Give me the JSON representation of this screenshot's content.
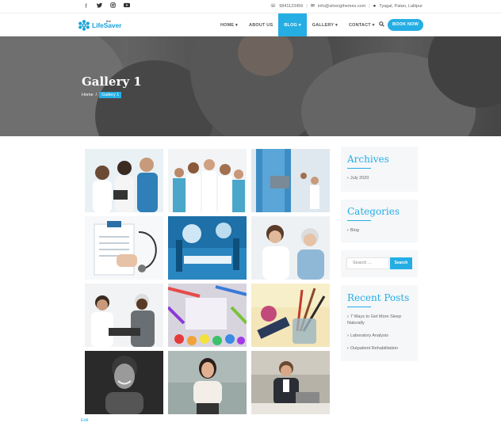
{
  "topbar": {
    "social_icons": [
      "facebook-icon",
      "twitter-icon",
      "instagram-icon",
      "youtube-icon"
    ],
    "phone": "9841123456",
    "email": "info@silvergthemes.com",
    "address": "Tyagal, Patan, Lalitpur"
  },
  "nav": {
    "logo_prefix": "the",
    "logo_text": "LifeSaver",
    "items": [
      {
        "label": "HOME",
        "dropdown": true
      },
      {
        "label": "ABOUT US",
        "dropdown": false
      },
      {
        "label": "BLOG",
        "dropdown": true,
        "active": true
      },
      {
        "label": "GALLERY",
        "dropdown": true
      },
      {
        "label": "CONTACT",
        "dropdown": true
      }
    ],
    "search_icon": "search-icon",
    "book_label": "BOOK NOW"
  },
  "hero": {
    "title": "Gallery 1",
    "breadcrumb_home": "Home",
    "breadcrumb_sep": "/",
    "breadcrumb_current": "Gallery 1"
  },
  "gallery": {
    "images": [
      "doctors-with-tablet",
      "medical-team",
      "doctor-with-tablet-xray",
      "clipboard-stethoscope",
      "surgery-room",
      "doctor-with-senior-patient",
      "doctor-consultation",
      "colored-pencils-palette",
      "pencils-in-jar",
      "smiling-man-portrait",
      "woman-seated-portrait",
      "businessman-at-laptop"
    ]
  },
  "edit_label": "Edit",
  "sidebar": {
    "archives": {
      "title": "Archives",
      "items": [
        "July 2020"
      ]
    },
    "categories": {
      "title": "Categories",
      "items": [
        "Blog"
      ]
    },
    "search": {
      "placeholder": "Search ...",
      "button": "Search"
    },
    "recent_posts": {
      "title": "Recent Posts",
      "items": [
        "7 Ways to Get More Sleep Naturally",
        "Laboratory Analysis",
        "Outpatient Rehabilitation"
      ]
    }
  },
  "colors": {
    "accent": "#25aee4"
  }
}
